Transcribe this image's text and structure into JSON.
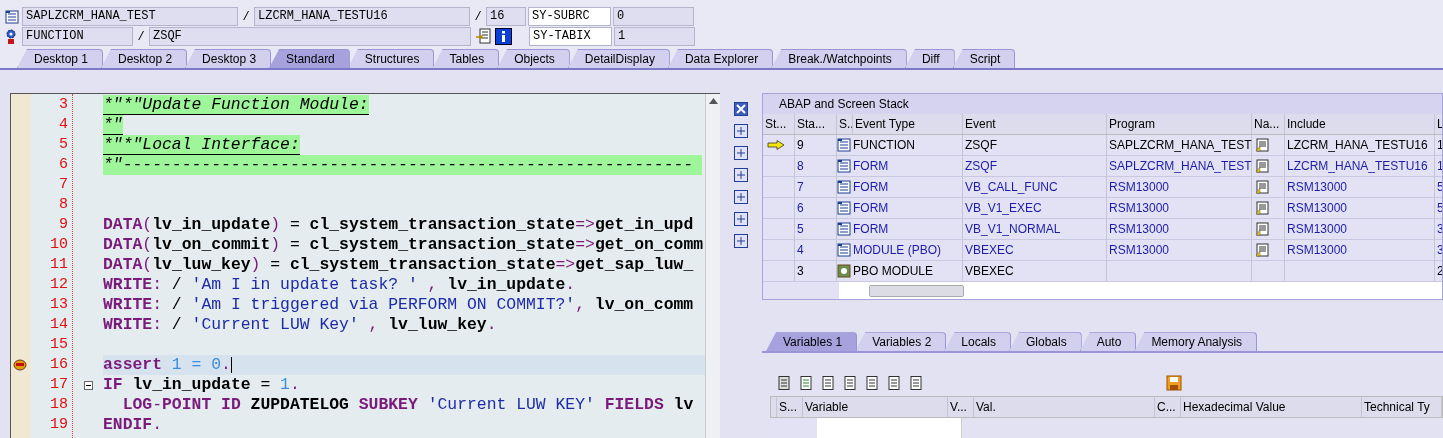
{
  "header": {
    "program": "SAPLZCRM_HANA_TEST",
    "include": "LZCRM_HANA_TESTU16",
    "line": "16",
    "event_type": "FUNCTION",
    "event": "ZSQF",
    "sysvars": [
      {
        "name": "SY-SUBRC",
        "value": "0"
      },
      {
        "name": "SY-TABIX",
        "value": "1"
      }
    ],
    "separators": [
      "/",
      "/",
      "/"
    ]
  },
  "tabs": [
    {
      "label": "Desktop 1",
      "selected": false
    },
    {
      "label": "Desktop 2",
      "selected": false
    },
    {
      "label": "Desktop 3",
      "selected": false
    },
    {
      "label": "Standard",
      "selected": true
    },
    {
      "label": "Structures",
      "selected": false
    },
    {
      "label": "Tables",
      "selected": false
    },
    {
      "label": "Objects",
      "selected": false
    },
    {
      "label": "DetailDisplay",
      "selected": false
    },
    {
      "label": "Data Explorer",
      "selected": false
    },
    {
      "label": "Break./Watchpoints",
      "selected": false
    },
    {
      "label": "Diff",
      "selected": false
    },
    {
      "label": "Script",
      "selected": false
    }
  ],
  "editor": {
    "lines": [
      {
        "number": "3",
        "breakpoint": false,
        "current": false,
        "fold": false,
        "tokens": [
          {
            "kind": "comment",
            "text": "*\"*\"Update Function Module:"
          }
        ]
      },
      {
        "number": "4",
        "breakpoint": false,
        "current": false,
        "fold": false,
        "tokens": [
          {
            "kind": "comment",
            "text": "*\""
          }
        ]
      },
      {
        "number": "5",
        "breakpoint": false,
        "current": false,
        "fold": false,
        "tokens": [
          {
            "kind": "comment",
            "text": "*\"*\"Local Interface:"
          }
        ]
      },
      {
        "number": "6",
        "breakpoint": false,
        "current": false,
        "fold": false,
        "tokens": [
          {
            "kind": "comment",
            "text": "*\"----------------------------------------------------------"
          }
        ]
      },
      {
        "number": "7",
        "breakpoint": false,
        "current": false,
        "fold": false
      },
      {
        "number": "8",
        "breakpoint": false,
        "current": false,
        "fold": false
      },
      {
        "number": "9",
        "breakpoint": false,
        "current": false,
        "fold": false,
        "tokens": [
          {
            "kind": "keyword",
            "text": "DATA"
          },
          {
            "kind": "op",
            "text": "("
          },
          {
            "kind": "ident",
            "text": "lv_in_update"
          },
          {
            "kind": "op",
            "text": ")"
          },
          {
            "kind": "plain",
            "text": " = "
          },
          {
            "kind": "ident",
            "text": "cl_system_transaction_state"
          },
          {
            "kind": "op",
            "text": "=>"
          },
          {
            "kind": "ident",
            "text": "get_in_upd"
          }
        ]
      },
      {
        "number": "10",
        "breakpoint": false,
        "current": false,
        "fold": false,
        "tokens": [
          {
            "kind": "keyword",
            "text": "DATA"
          },
          {
            "kind": "op",
            "text": "("
          },
          {
            "kind": "ident",
            "text": "lv_on_commit"
          },
          {
            "kind": "op",
            "text": ")"
          },
          {
            "kind": "plain",
            "text": " = "
          },
          {
            "kind": "ident",
            "text": "cl_system_transaction_state"
          },
          {
            "kind": "op",
            "text": "=>"
          },
          {
            "kind": "ident",
            "text": "get_on_comm"
          }
        ]
      },
      {
        "number": "11",
        "breakpoint": false,
        "current": false,
        "fold": false,
        "tokens": [
          {
            "kind": "keyword",
            "text": "DATA"
          },
          {
            "kind": "op",
            "text": "("
          },
          {
            "kind": "ident",
            "text": "lv_luw_key"
          },
          {
            "kind": "op",
            "text": ")"
          },
          {
            "kind": "plain",
            "text": " = "
          },
          {
            "kind": "ident",
            "text": "cl_system_transaction_state"
          },
          {
            "kind": "op",
            "text": "=>"
          },
          {
            "kind": "ident",
            "text": "get_sap_luw_"
          }
        ]
      },
      {
        "number": "12",
        "breakpoint": false,
        "current": false,
        "fold": false,
        "tokens": [
          {
            "kind": "keyword",
            "text": "WRITE"
          },
          {
            "kind": "op",
            "text": ":"
          },
          {
            "kind": "plain",
            "text": " / "
          },
          {
            "kind": "string",
            "text": "'Am I in update task? '"
          },
          {
            "kind": "op",
            "text": " , "
          },
          {
            "kind": "ident",
            "text": "lv_in_update"
          },
          {
            "kind": "op",
            "text": "."
          }
        ]
      },
      {
        "number": "13",
        "breakpoint": false,
        "current": false,
        "fold": false,
        "tokens": [
          {
            "kind": "keyword",
            "text": "WRITE"
          },
          {
            "kind": "op",
            "text": ":"
          },
          {
            "kind": "plain",
            "text": " / "
          },
          {
            "kind": "string",
            "text": "'Am I triggered via PERFORM ON COMMIT?'"
          },
          {
            "kind": "op",
            "text": ", "
          },
          {
            "kind": "ident",
            "text": "lv_on_comm"
          }
        ]
      },
      {
        "number": "14",
        "breakpoint": false,
        "current": false,
        "fold": false,
        "tokens": [
          {
            "kind": "keyword",
            "text": "WRITE"
          },
          {
            "kind": "op",
            "text": ":"
          },
          {
            "kind": "plain",
            "text": " / "
          },
          {
            "kind": "string",
            "text": "'Current LUW Key'"
          },
          {
            "kind": "op",
            "text": " , "
          },
          {
            "kind": "ident",
            "text": "lv_luw_key"
          },
          {
            "kind": "op",
            "text": "."
          }
        ]
      },
      {
        "number": "15",
        "breakpoint": false,
        "current": false,
        "fold": false
      },
      {
        "number": "16",
        "breakpoint": true,
        "current": true,
        "fold": false,
        "tokens": [
          {
            "kind": "keyword",
            "text": "assert"
          },
          {
            "kind": "number",
            "text": " 1 "
          },
          {
            "kind": "number",
            "text": "= 0"
          },
          {
            "kind": "op",
            "text": "."
          }
        ]
      },
      {
        "number": "17",
        "breakpoint": false,
        "current": false,
        "fold": true,
        "tokens": [
          {
            "kind": "keyword",
            "text": "IF"
          },
          {
            "kind": "ident",
            "text": " lv_in_update"
          },
          {
            "kind": "plain",
            "text": " = "
          },
          {
            "kind": "number",
            "text": "1"
          },
          {
            "kind": "op",
            "text": "."
          }
        ]
      },
      {
        "number": "18",
        "breakpoint": false,
        "current": false,
        "fold": false,
        "tokens": [
          {
            "kind": "keyword",
            "text": "  LOG"
          },
          {
            "kind": "op",
            "text": "-"
          },
          {
            "kind": "keyword",
            "text": "POINT ID"
          },
          {
            "kind": "ident",
            "text": " ZUPDATELOG"
          },
          {
            "kind": "keyword",
            "text": " SUBKEY"
          },
          {
            "kind": "string",
            "text": " 'Current LUW KEY'"
          },
          {
            "kind": "keyword",
            "text": " FIELDS"
          },
          {
            "kind": "ident",
            "text": " lv"
          }
        ]
      },
      {
        "number": "19",
        "breakpoint": false,
        "current": false,
        "fold": false,
        "tokens": [
          {
            "kind": "keyword",
            "text": "ENDIF"
          },
          {
            "kind": "op",
            "text": "."
          }
        ]
      }
    ]
  },
  "stack": {
    "title": "ABAP and Screen Stack",
    "columns": [
      "St...",
      "Sta...",
      "S..",
      "Event Type",
      "Event",
      "Program",
      "Na...",
      "Include",
      "L"
    ],
    "rows": [
      {
        "active": true,
        "level": "9",
        "kind": "abap",
        "event_type": "FUNCTION",
        "event": "ZSQF",
        "program": "SAPLZCRM_HANA_TEST",
        "navigable": true,
        "include": "LZCRM_HANA_TESTU16",
        "column_9": "1",
        "color": "#000000"
      },
      {
        "active": false,
        "level": "8",
        "kind": "abap",
        "event_type": "FORM",
        "event": "ZSQF",
        "program": "SAPLZCRM_HANA_TEST",
        "navigable": true,
        "include": "LZCRM_HANA_TESTU16",
        "column_9": "1",
        "color": "#1c1ca8"
      },
      {
        "active": false,
        "level": "7",
        "kind": "abap",
        "event_type": "FORM",
        "event": "VB_CALL_FUNC",
        "program": "RSM13000",
        "navigable": true,
        "include": "RSM13000",
        "column_9": "5",
        "color": "#1c1ca8"
      },
      {
        "active": false,
        "level": "6",
        "kind": "abap",
        "event_type": "FORM",
        "event": "VB_V1_EXEC",
        "program": "RSM13000",
        "navigable": true,
        "include": "RSM13000",
        "column_9": "5",
        "color": "#1c1ca8"
      },
      {
        "active": false,
        "level": "5",
        "kind": "abap",
        "event_type": "FORM",
        "event": "VB_V1_NORMAL",
        "program": "RSM13000",
        "navigable": true,
        "include": "RSM13000",
        "column_9": "3",
        "color": "#1c1ca8"
      },
      {
        "active": false,
        "level": "4",
        "kind": "abap",
        "event_type": "MODULE (PBO)",
        "event": "VBEXEC",
        "program": "RSM13000",
        "navigable": true,
        "include": "RSM13000",
        "column_9": "3",
        "color": "#1c1ca8"
      },
      {
        "active": false,
        "level": "3",
        "kind": "screen",
        "event_type": "PBO MODULE",
        "event": "VBEXEC",
        "navigable": false,
        "column_9": "2",
        "color": "#000000"
      }
    ]
  },
  "var_tabs": [
    {
      "label": "Variables 1",
      "selected": true
    },
    {
      "label": "Variables 2",
      "selected": false
    },
    {
      "label": "Locals",
      "selected": false
    },
    {
      "label": "Globals",
      "selected": false
    },
    {
      "label": "Auto",
      "selected": false
    },
    {
      "label": "Memory Analysis",
      "selected": false
    }
  ],
  "var_grid": {
    "columns": [
      "S...",
      "Variable",
      "V...",
      "Val.",
      "C...",
      "Hexadecimal Value",
      "Technical Ty"
    ]
  }
}
